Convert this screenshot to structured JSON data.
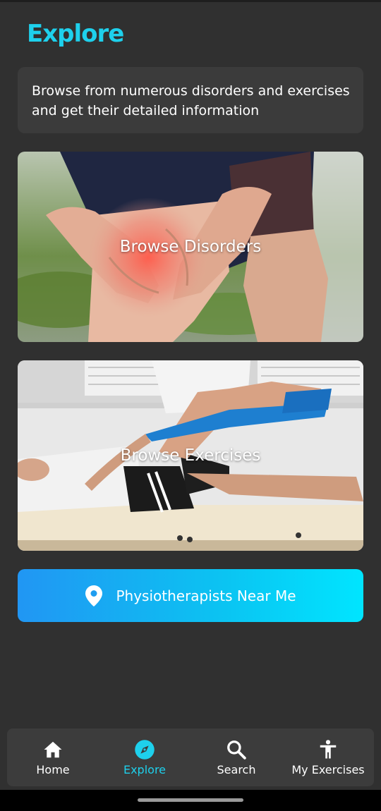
{
  "header": {
    "title": "Explore"
  },
  "intro": {
    "text": "Browse from numerous disorders and exercises and get their detailed information"
  },
  "cards": {
    "disorders": {
      "label": "Browse Disorders",
      "image": "knee-pain-photo"
    },
    "exercises": {
      "label": "Browse Exercises",
      "image": "resistance-band-exercise-photo"
    }
  },
  "physio_button": {
    "label": "Physiotherapists Near Me",
    "icon": "location-pin-icon"
  },
  "bottom_nav": {
    "items": [
      {
        "label": "Home",
        "icon": "home-icon",
        "active": false
      },
      {
        "label": "Explore",
        "icon": "compass-icon",
        "active": true
      },
      {
        "label": "Search",
        "icon": "search-icon",
        "active": false
      },
      {
        "label": "My Exercises",
        "icon": "person-icon",
        "active": false
      }
    ]
  },
  "colors": {
    "accent": "#1ed0ec",
    "background": "#303030",
    "card": "#3b3b3b",
    "button_gradient_start": "#2196f3",
    "button_gradient_end": "#00e5ff"
  }
}
